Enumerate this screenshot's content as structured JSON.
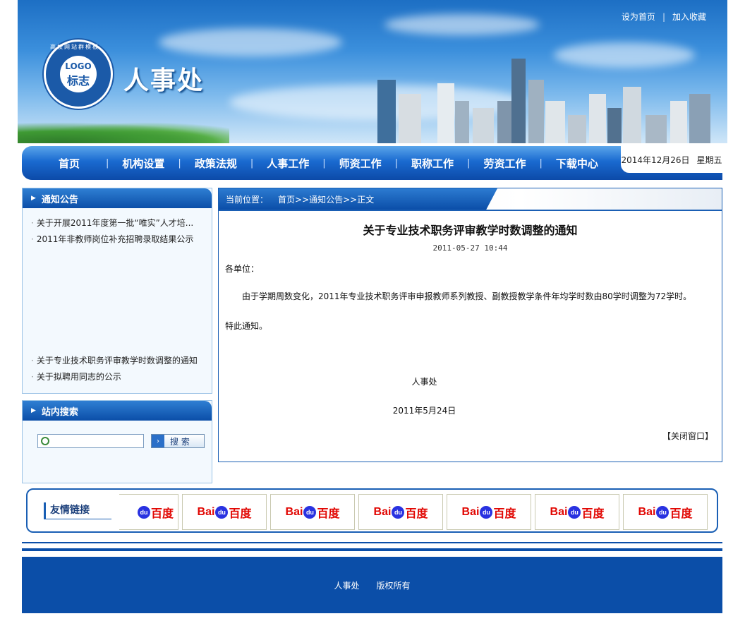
{
  "header": {
    "top_links": [
      "设为首页",
      "加入收藏"
    ],
    "logo_text": "LOGO",
    "logo_sub": "标志",
    "logo_ring": "高校网站群模板",
    "site_title": "人事处"
  },
  "nav": {
    "items": [
      "首页",
      "机构设置",
      "政策法规",
      "人事工作",
      "师资工作",
      "职称工作",
      "劳资工作",
      "下载中心"
    ],
    "date": "2014年12月26日",
    "weekday": "星期五"
  },
  "notice_panel": {
    "title": "通知公告",
    "items_top": [
      "关于开展2011年度第一批“唯实”人才培...",
      "2011年非教师岗位补充招聘录取结果公示"
    ],
    "items_bottom": [
      "关于专业技术职务评审教学时数调整的通知",
      "关于拟聘用同志的公示"
    ]
  },
  "search_panel": {
    "title": "站内搜索",
    "button_label": "搜 索"
  },
  "breadcrumb": {
    "prefix": "当前位置：",
    "path": "首页>>通知公告>>正文"
  },
  "article": {
    "title": "关于专业技术职务评审教学时数调整的通知",
    "time": "2011-05-27 10:44",
    "salutation": "各单位：",
    "body": "由于学期周数变化，2011年专业技术职务评审申报教师系列教授、副教授教学条件年均学时数由80学时调整为72学时。",
    "closing": "特此通知。",
    "signature": "人事处",
    "sign_date": "2011年5月24日",
    "close_label": "【关闭窗口】"
  },
  "friends": {
    "label": "友情链接",
    "logo_name": "Baidu百度"
  },
  "footer": {
    "left": "人事处",
    "right": "版权所有"
  }
}
